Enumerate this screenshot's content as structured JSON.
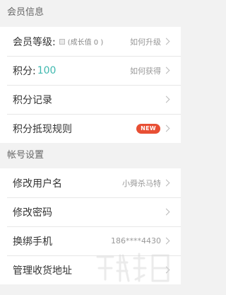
{
  "member_section": {
    "title": "会员信息",
    "rows": [
      {
        "label": "会员等级:",
        "growth": "(成长值 0 )",
        "value": "如何升级"
      },
      {
        "label": "积分:",
        "points": "100",
        "value": "如何获得"
      },
      {
        "label": "积分记录"
      },
      {
        "label": "积分抵现规则",
        "badge": "NEW"
      }
    ]
  },
  "account_section": {
    "title": "帐号设置",
    "rows": [
      {
        "label": "修改用户名",
        "value": "小舜杀马特"
      },
      {
        "label": "修改密码"
      },
      {
        "label": "换绑手机",
        "value": "186****4430"
      },
      {
        "label": "管理收货地址"
      }
    ]
  },
  "colors": {
    "background": "#f2f2f2",
    "accent": "#3fb8af",
    "badge": "#e84f34"
  }
}
